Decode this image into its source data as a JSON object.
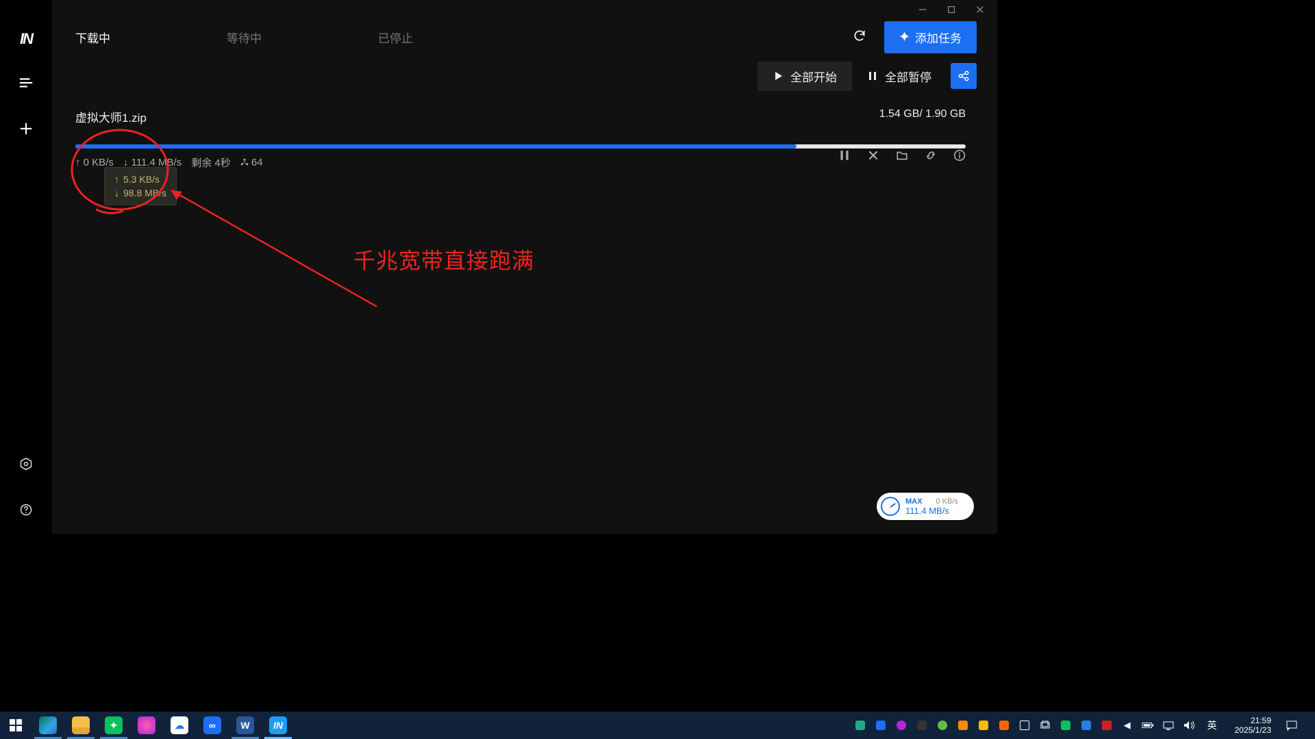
{
  "window_controls": {
    "min": "—",
    "max": "▭",
    "close": "✕"
  },
  "sidebar": {
    "logo": "IN"
  },
  "tabs": [
    {
      "id": "downloading",
      "label": "下载中",
      "active": true
    },
    {
      "id": "waiting",
      "label": "等待中",
      "active": false
    },
    {
      "id": "stopped",
      "label": "已停止",
      "active": false
    }
  ],
  "add_task_label": "添加任务",
  "actions": {
    "start_all": "全部开始",
    "pause_all": "全部暂停"
  },
  "item": {
    "name": "虚拟大师1.zip",
    "size_done": "1.54 GB",
    "size_total": "1.90 GB",
    "progress_percent": 81,
    "up_speed": "0 KB/s",
    "down_speed": "111.4 MB/s",
    "remaining": "剩余 4秒",
    "connections": "64"
  },
  "tooltip": {
    "up": "5.3 KB/s",
    "down": "98.8 MB/s"
  },
  "annotation_text": "千兆宽带直接跑满",
  "speed_widget": {
    "label": "MAX",
    "up": "0 KB/s",
    "down": "111.4 MB/s"
  },
  "taskbar": {
    "ime": "英",
    "time": "21:59",
    "date": "2025/1/23"
  }
}
